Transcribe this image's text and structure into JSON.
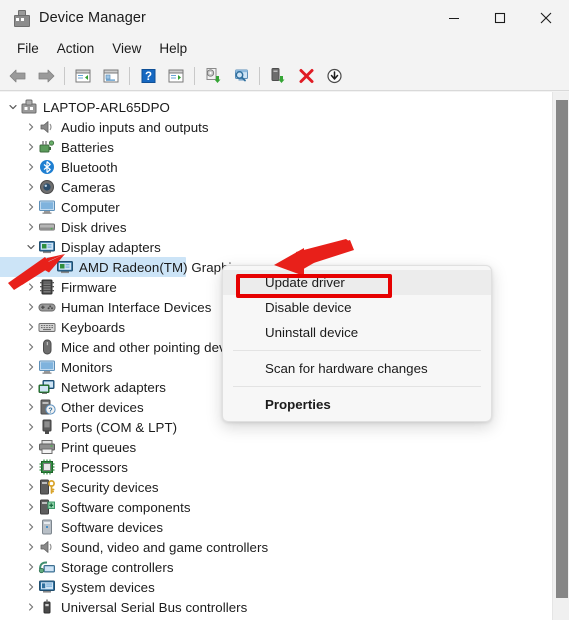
{
  "window": {
    "title": "Device Manager",
    "icon": "device-manager-icon",
    "controls": [
      {
        "name": "minimize-button",
        "glyph": "minimize"
      },
      {
        "name": "maximize-button",
        "glyph": "maximize"
      },
      {
        "name": "close-button",
        "glyph": "close"
      }
    ]
  },
  "menubar": {
    "items": [
      {
        "label": "File"
      },
      {
        "label": "Action"
      },
      {
        "label": "View"
      },
      {
        "label": "Help"
      }
    ]
  },
  "toolbar": {
    "buttons": [
      {
        "name": "back-button",
        "icon": "back-arrow-icon"
      },
      {
        "name": "forward-button",
        "icon": "forward-arrow-icon"
      },
      {
        "name": "separator-1",
        "icon": "separator"
      },
      {
        "name": "up-one-level-button",
        "icon": "window-list-icon"
      },
      {
        "name": "show-hide-console-tree-button",
        "icon": "console-tree-icon"
      },
      {
        "name": "separator-2",
        "icon": "separator"
      },
      {
        "name": "help-button",
        "icon": "help-question-icon"
      },
      {
        "name": "properties-button",
        "icon": "properties-window-icon"
      },
      {
        "name": "separator-3",
        "icon": "separator"
      },
      {
        "name": "update-driver-button",
        "icon": "update-driver-icon"
      },
      {
        "name": "scan-hardware-changes-button",
        "icon": "scan-monitor-icon"
      },
      {
        "name": "separator-4",
        "icon": "separator"
      },
      {
        "name": "enable-device-button",
        "icon": "enable-device-icon"
      },
      {
        "name": "uninstall-device-button",
        "icon": "red-x-icon"
      },
      {
        "name": "disable-device-button",
        "icon": "down-arrow-circle-icon"
      }
    ]
  },
  "tree": {
    "nodes": [
      {
        "label": "LAPTOP-ARL65DPO",
        "depth": 0,
        "expanded": true,
        "chevron": "chevron-down",
        "icon": "computer-root-icon",
        "selected": false
      },
      {
        "label": "Audio inputs and outputs",
        "depth": 1,
        "expanded": false,
        "chevron": "chevron-right",
        "icon": "speaker-icon",
        "selected": false
      },
      {
        "label": "Batteries",
        "depth": 1,
        "expanded": false,
        "chevron": "chevron-right",
        "icon": "battery-icon",
        "selected": false
      },
      {
        "label": "Bluetooth",
        "depth": 1,
        "expanded": false,
        "chevron": "chevron-right",
        "icon": "bluetooth-icon",
        "selected": false
      },
      {
        "label": "Cameras",
        "depth": 1,
        "expanded": false,
        "chevron": "chevron-right",
        "icon": "camera-icon",
        "selected": false
      },
      {
        "label": "Computer",
        "depth": 1,
        "expanded": false,
        "chevron": "chevron-right",
        "icon": "monitor-icon",
        "selected": false
      },
      {
        "label": "Disk drives",
        "depth": 1,
        "expanded": false,
        "chevron": "chevron-right",
        "icon": "disk-drive-icon",
        "selected": false
      },
      {
        "label": "Display adapters",
        "depth": 1,
        "expanded": true,
        "chevron": "chevron-down",
        "icon": "display-adapter-icon",
        "selected": false
      },
      {
        "label": "AMD Radeon(TM) Graphics",
        "depth": 2,
        "expanded": false,
        "chevron": "none",
        "icon": "display-adapter-icon",
        "selected": true
      },
      {
        "label": "Firmware",
        "depth": 1,
        "expanded": false,
        "chevron": "chevron-right",
        "icon": "firmware-chip-icon",
        "selected": false
      },
      {
        "label": "Human Interface Devices",
        "depth": 1,
        "expanded": false,
        "chevron": "chevron-right",
        "icon": "hid-gamepad-icon",
        "selected": false
      },
      {
        "label": "Keyboards",
        "depth": 1,
        "expanded": false,
        "chevron": "chevron-right",
        "icon": "keyboard-icon",
        "selected": false
      },
      {
        "label": "Mice and other pointing devices",
        "depth": 1,
        "expanded": false,
        "chevron": "chevron-right",
        "icon": "mouse-icon",
        "selected": false
      },
      {
        "label": "Monitors",
        "depth": 1,
        "expanded": false,
        "chevron": "chevron-right",
        "icon": "monitor-icon",
        "selected": false
      },
      {
        "label": "Network adapters",
        "depth": 1,
        "expanded": false,
        "chevron": "chevron-right",
        "icon": "network-adapter-icon",
        "selected": false
      },
      {
        "label": "Other devices",
        "depth": 1,
        "expanded": false,
        "chevron": "chevron-right",
        "icon": "other-device-icon",
        "selected": false
      },
      {
        "label": "Ports (COM & LPT)",
        "depth": 1,
        "expanded": false,
        "chevron": "chevron-right",
        "icon": "port-icon",
        "selected": false
      },
      {
        "label": "Print queues",
        "depth": 1,
        "expanded": false,
        "chevron": "chevron-right",
        "icon": "printer-icon",
        "selected": false
      },
      {
        "label": "Processors",
        "depth": 1,
        "expanded": false,
        "chevron": "chevron-right",
        "icon": "processor-icon",
        "selected": false
      },
      {
        "label": "Security devices",
        "depth": 1,
        "expanded": false,
        "chevron": "chevron-right",
        "icon": "security-key-icon",
        "selected": false
      },
      {
        "label": "Software components",
        "depth": 1,
        "expanded": false,
        "chevron": "chevron-right",
        "icon": "software-component-icon",
        "selected": false
      },
      {
        "label": "Software devices",
        "depth": 1,
        "expanded": false,
        "chevron": "chevron-right",
        "icon": "software-device-icon",
        "selected": false
      },
      {
        "label": "Sound, video and game controllers",
        "depth": 1,
        "expanded": false,
        "chevron": "chevron-right",
        "icon": "speaker-icon",
        "selected": false
      },
      {
        "label": "Storage controllers",
        "depth": 1,
        "expanded": false,
        "chevron": "chevron-right",
        "icon": "storage-controller-icon",
        "selected": false
      },
      {
        "label": "System devices",
        "depth": 1,
        "expanded": false,
        "chevron": "chevron-right",
        "icon": "system-device-icon",
        "selected": false
      },
      {
        "label": "Universal Serial Bus controllers",
        "depth": 1,
        "expanded": false,
        "chevron": "chevron-right",
        "icon": "usb-icon",
        "selected": false
      }
    ]
  },
  "context_menu": {
    "items": [
      {
        "label": "Update driver",
        "highlighted": true,
        "bold": false,
        "name": "context-menu-update-driver"
      },
      {
        "label": "Disable device",
        "highlighted": false,
        "bold": false,
        "name": "context-menu-disable-device"
      },
      {
        "label": "Uninstall device",
        "highlighted": false,
        "bold": false,
        "name": "context-menu-uninstall-device"
      },
      {
        "label": "Scan for hardware changes",
        "highlighted": false,
        "bold": false,
        "name": "context-menu-scan-hardware-changes"
      },
      {
        "label": "Properties",
        "highlighted": false,
        "bold": true,
        "name": "context-menu-properties"
      }
    ]
  },
  "annotations": {
    "highlight_color": "#e60000",
    "arrows": [
      {
        "name": "annotation-arrow-display-adapters",
        "points_to": "Display adapters expand chevron"
      },
      {
        "name": "annotation-arrow-update-driver",
        "points_to": "Update driver menu item"
      }
    ],
    "box": {
      "name": "annotation-box-update-driver",
      "target": "Update driver"
    }
  },
  "scrollbar": {
    "name": "vertical-scrollbar",
    "orientation": "vertical"
  }
}
